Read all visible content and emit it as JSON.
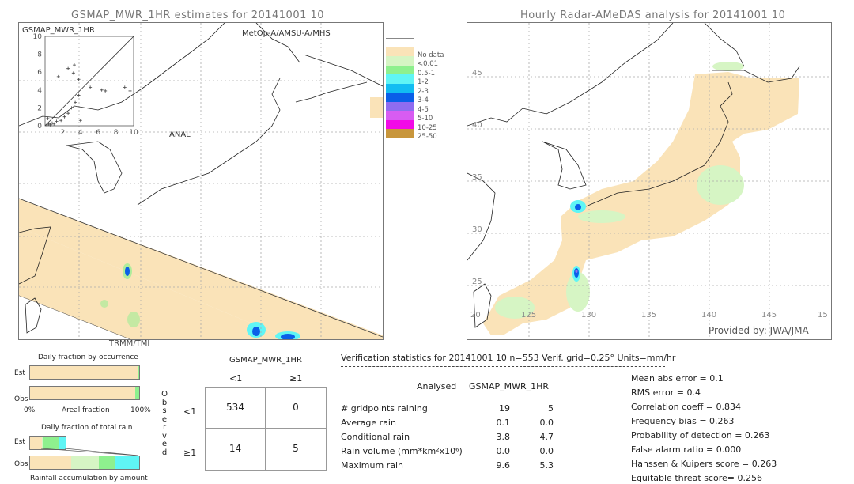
{
  "left_map": {
    "title": "GSMAP_MWR_1HR estimates for 20141001 10",
    "inset_title": "GSMAP_MWR_1HR",
    "inset_y_ticks": [
      "10",
      "8",
      "6",
      "4",
      "2",
      "0"
    ],
    "inset_x_ticks": [
      "2",
      "4",
      "6",
      "8",
      "10"
    ],
    "inset_x_label": "ANAL",
    "sensor_top": "MetOp-A/AMSU-A/MHS",
    "sensor_bottom": "TRMM/TMI"
  },
  "right_map": {
    "title": "Hourly Radar-AMeDAS analysis for 20141001 10",
    "lat_ticks": [
      "45",
      "40",
      "35",
      "30",
      "25",
      "20"
    ],
    "lon_ticks": [
      "125",
      "130",
      "135",
      "140",
      "145",
      "15"
    ],
    "lon_start": "20",
    "credit": "Provided by: JWA/JMA"
  },
  "legend": {
    "items": [
      {
        "label": "",
        "color": "#ffffff"
      },
      {
        "label": "No data",
        "color": "#fae3b8"
      },
      {
        "label": "<0.01",
        "color": "#d6f5c4"
      },
      {
        "label": "0.5-1",
        "color": "#8ef08e"
      },
      {
        "label": "1-2",
        "color": "#5ff5f5"
      },
      {
        "label": "2-3",
        "color": "#12bdf2"
      },
      {
        "label": "3-4",
        "color": "#0a5fe8"
      },
      {
        "label": "4-5",
        "color": "#8f6cf0"
      },
      {
        "label": "5-10",
        "color": "#d85cf2"
      },
      {
        "label": "10-25",
        "color": "#f20ae6"
      },
      {
        "label": "25-50",
        "color": "#c8963c"
      }
    ]
  },
  "occurrence": {
    "title": "Daily fraction by occurrence",
    "est_label": "Est",
    "obs_label": "Obs",
    "axis_left": "0%",
    "axis_mid": "Areal fraction",
    "axis_right": "100%",
    "est_nodata_fraction": 0.99,
    "obs_nodata_fraction": 0.966
  },
  "total_rain": {
    "title": "Daily fraction of total rain",
    "est_label": "Est",
    "obs_label": "Obs",
    "footer": "Rainfall accumulation by amount",
    "est_segments": [
      {
        "color": "#fae3b8",
        "fraction": 0.33
      },
      {
        "color": "#d6f5c4",
        "fraction": 0.05
      },
      {
        "color": "#8ef08e",
        "fraction": 0.42
      },
      {
        "color": "#5ff5f5",
        "fraction": 0.2
      }
    ],
    "obs_segments": [
      {
        "color": "#fae3b8",
        "fraction": 0.38
      },
      {
        "color": "#d6f5c4",
        "fraction": 0.25
      },
      {
        "color": "#8ef08e",
        "fraction": 0.15
      },
      {
        "color": "#5ff5f5",
        "fraction": 0.22
      }
    ]
  },
  "contingency": {
    "title": "GSMAP_MWR_1HR",
    "col_headers": [
      "<1",
      "≥1"
    ],
    "row_headers": [
      "<1",
      "≥1"
    ],
    "side_label": [
      "O",
      "b",
      "s",
      "e",
      "r",
      "v",
      "e",
      "d"
    ],
    "cells": [
      [
        "534",
        "0"
      ],
      [
        "14",
        "5"
      ]
    ]
  },
  "verification": {
    "header": "Verification statistics for 20141001 10   n=553   Verif. grid=0.25°   Units=mm/hr",
    "col_analysed": "Analysed",
    "col_model": "GSMAP_MWR_1HR",
    "rows": [
      {
        "label": "# gridpoints raining",
        "analysed": "19",
        "model": "5"
      },
      {
        "label": "Average rain",
        "analysed": "0.1",
        "model": "0.0"
      },
      {
        "label": "Conditional rain",
        "analysed": "3.8",
        "model": "4.7"
      },
      {
        "label": "Rain volume (mm*km²x10⁶)",
        "analysed": "0.0",
        "model": "0.0"
      },
      {
        "label": "Maximum rain",
        "analysed": "9.6",
        "model": "5.3"
      }
    ],
    "scores": [
      "Mean abs error = 0.1",
      "RMS error = 0.4",
      "Correlation coeff = 0.834",
      "Frequency bias = 0.263",
      "Probability of detection = 0.263",
      "False alarm ratio = 0.000",
      "Hanssen & Kuipers score = 0.263",
      "Equitable threat score= 0.256"
    ]
  },
  "chart_data": [
    {
      "type": "scatter",
      "title": "GSMAP_MWR_1HR",
      "xlabel": "ANAL",
      "ylabel": "GSMAP_MWR_1HR",
      "xlim": [
        0,
        10
      ],
      "ylim": [
        0,
        10
      ],
      "x_ticks": [
        2,
        4,
        6,
        8,
        10
      ],
      "y_ticks": [
        0,
        2,
        4,
        6,
        8,
        10
      ],
      "diagonal": true,
      "points": [
        {
          "x": 0.2,
          "y": 0.1
        },
        {
          "x": 0.4,
          "y": 0.2
        },
        {
          "x": 0.6,
          "y": 0.1
        },
        {
          "x": 0.8,
          "y": 0.3
        },
        {
          "x": 1.0,
          "y": 0.2
        },
        {
          "x": 1.3,
          "y": 0.5
        },
        {
          "x": 1.8,
          "y": 0.6
        },
        {
          "x": 2.2,
          "y": 1.0
        },
        {
          "x": 2.6,
          "y": 1.4
        },
        {
          "x": 3.0,
          "y": 2.0
        },
        {
          "x": 3.4,
          "y": 2.6
        },
        {
          "x": 3.8,
          "y": 3.4
        },
        {
          "x": 2.6,
          "y": 6.4
        },
        {
          "x": 3.2,
          "y": 5.9
        },
        {
          "x": 3.3,
          "y": 6.8
        },
        {
          "x": 1.5,
          "y": 5.5
        },
        {
          "x": 3.8,
          "y": 5.2
        },
        {
          "x": 5.1,
          "y": 4.3
        },
        {
          "x": 6.4,
          "y": 4.0
        },
        {
          "x": 6.8,
          "y": 3.9
        },
        {
          "x": 9.0,
          "y": 4.3
        },
        {
          "x": 9.6,
          "y": 3.9
        },
        {
          "x": 4.0,
          "y": 0.6
        },
        {
          "x": 0.3,
          "y": 0.8
        }
      ]
    },
    {
      "type": "table",
      "title": "Contingency table",
      "columns": [
        "<1",
        "≥1"
      ],
      "rows": [
        {
          "obs": "<1",
          "values": [
            534,
            0
          ]
        },
        {
          "obs": "≥1",
          "values": [
            14,
            5
          ]
        }
      ]
    }
  ]
}
